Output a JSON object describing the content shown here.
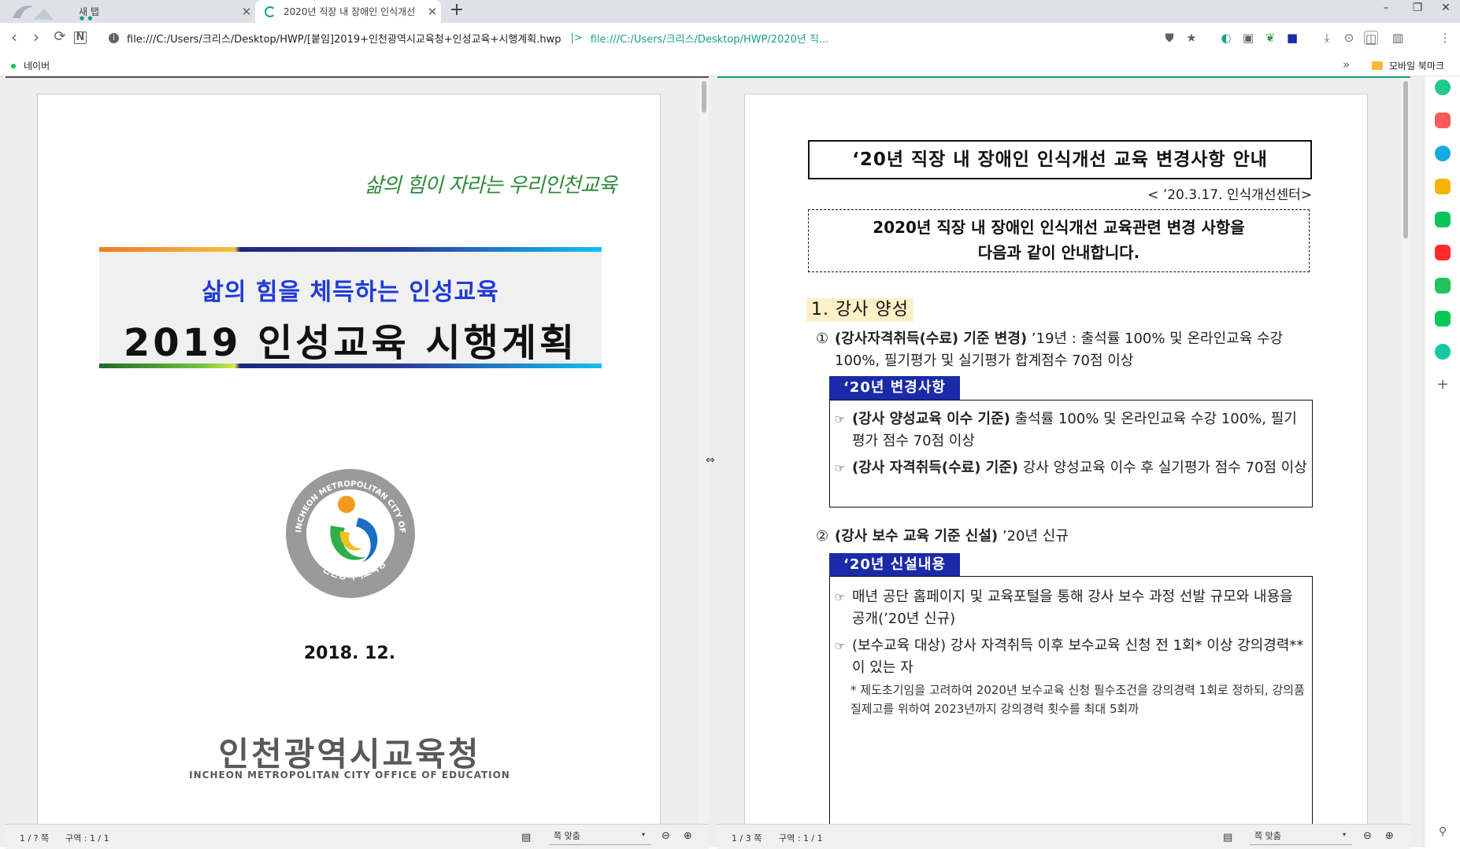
{
  "browser": {
    "tabs": [
      {
        "title": "새 탭",
        "active": false
      },
      {
        "title": "2020년 직장 내 장애인 인식개선",
        "active": true
      }
    ],
    "new_tab": "+",
    "window_controls": [
      "–",
      "❐",
      "✕"
    ],
    "url_main": "file:///C:/Users/크리스/Desktop/HWP/[붙임]2019+인천광역시교육청+인성교육+시행계획.hwp",
    "url_separator": "|>",
    "url_second": "file:///C:/Users/크리스/Desktop/HWP/2020년 직...",
    "bookmarks": [
      {
        "label": "네이버"
      }
    ],
    "bookmarks_more": "»",
    "mobile_bookmarks": "모바일 북마크"
  },
  "left_doc": {
    "slogan": "삶의 힘이 자라는 우리인천교육",
    "title_sub": "삶의 힘을 체득하는 인성교육",
    "title_main": "2019 인성교육 시행계획",
    "emblem_text_top": "INCHEON METROPOLITAN CITY OFFICE OF EDUCATION",
    "emblem_text_bottom": "인천광역시교육청",
    "date": "2018.  12.",
    "org_ko": "인천광역시교육청",
    "org_en": "INCHEON METROPOLITAN CITY OFFICE OF EDUCATION",
    "status": {
      "page": "1 / ? 쪽",
      "section": "구역 : 1 / 1",
      "zoom": "쪽 맞춤"
    }
  },
  "right_doc": {
    "title": "‘20년 직장 내 장애인 인식개선 교육 변경사항 안내",
    "date_line": "< ’20.3.17.  인식개선센터>",
    "intro_line1": "2020년 직장 내 장애인 인식개선 교육관련 변경 사항을",
    "intro_line2": "다음과 같이 안내합니다.",
    "section1": "1. 강사 양성",
    "item1": {
      "num": "①",
      "bold": "(강사자격취득(수료) 기준 변경)",
      "rest": " ’19년 : 출석률 100% 및 온라인교육 수강 100%, 필기평가 및 실기평가 합계점수 70점 이상"
    },
    "tag1": "‘20년 변경사항",
    "box1": [
      {
        "bold": "(강사 양성교육 이수 기준)",
        "rest": " 출석률 100% 및 온라인교육 수강 100%, 필기평가 점수 70점 이상"
      },
      {
        "bold": "(강사 자격취득(수료) 기준)",
        "rest": " 강사 양성교육 이수 후 실기평가 점수 70점 이상"
      }
    ],
    "item2": {
      "num": "②",
      "bold": "(강사 보수 교육 기준 신설)",
      "rest": " ’20년 신규"
    },
    "tag2": "‘20년 신설내용",
    "box2": [
      {
        "bold": "",
        "rest": "매년 공단 홈페이지 및 교육포털을 통해 강사 보수 과정 선발 규모와 내용을 공개(’20년 신규)"
      },
      {
        "bold": "",
        "rest": "(보수교육 대상) 강사 자격취득 이후 보수교육 신청 전 1회* 이상 강의경력**이 있는 자"
      }
    ],
    "note": "* 제도초기임을 고려하여 2020년 보수교육 신청 필수조건을 강의경력 1회로 정하되, 강의품질제고를 위하여 2023년까지 강의경력 횟수를 최대 5회까",
    "status": {
      "page": "1 / 3 쪽",
      "section": "구역 : 1 / 1",
      "zoom": "쪽 맞춤"
    }
  },
  "colors": {
    "accent": "#1a9f8a",
    "tag_blue": "#1a2aa8",
    "title_blue": "#1f3ad6"
  }
}
